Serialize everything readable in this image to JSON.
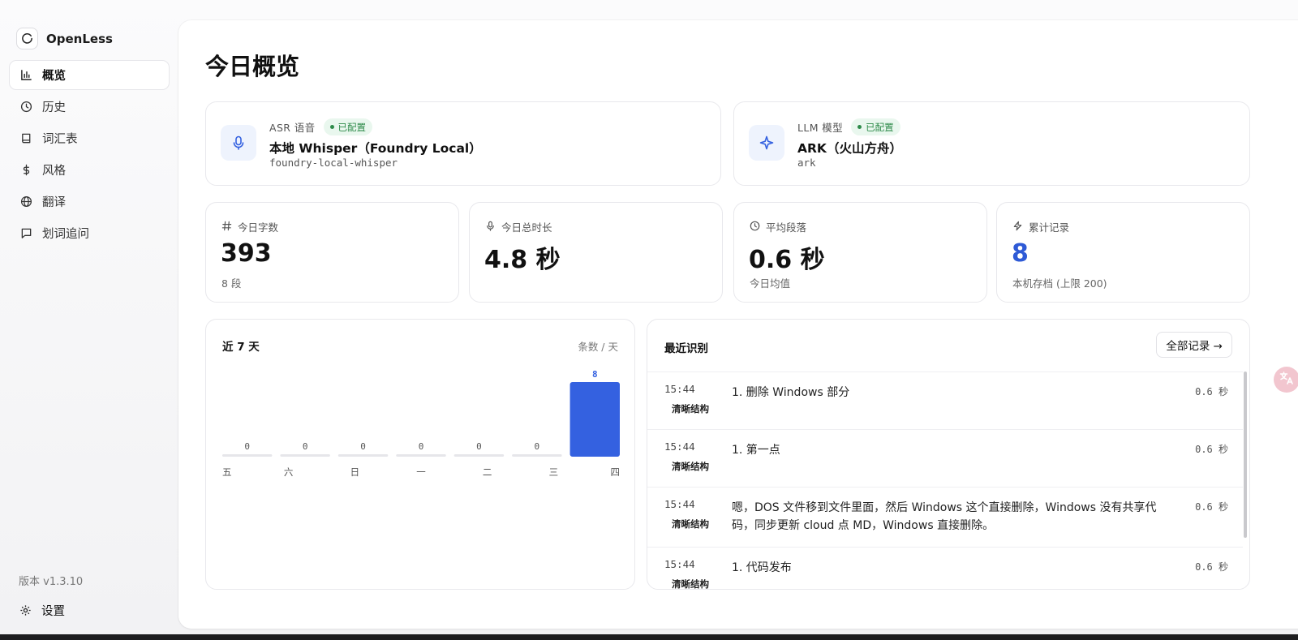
{
  "app": {
    "name": "OpenLess",
    "version": "版本 v1.3.10",
    "settings_label": "设置"
  },
  "sidebar": {
    "items": [
      {
        "label": "概览",
        "icon": "bar-chart-icon",
        "active": true
      },
      {
        "label": "历史",
        "icon": "clock-icon",
        "active": false
      },
      {
        "label": "词汇表",
        "icon": "book-icon",
        "active": false
      },
      {
        "label": "风格",
        "icon": "dollar-icon",
        "active": false
      },
      {
        "label": "翻译",
        "icon": "globe-icon",
        "active": false
      },
      {
        "label": "划词追问",
        "icon": "message-icon",
        "active": false
      }
    ]
  },
  "page": {
    "title": "今日概览"
  },
  "models": {
    "asr": {
      "kind": "ASR 语音",
      "badge": "已配置",
      "name": "本地 Whisper（Foundry Local）",
      "id": "foundry-local-whisper",
      "icon": "microphone-icon"
    },
    "llm": {
      "kind": "LLM 模型",
      "badge": "已配置",
      "name": "ARK（火山方舟）",
      "id": "ark",
      "icon": "sparkle-icon"
    }
  },
  "stats": [
    {
      "label": "今日字数",
      "value": "393",
      "sub": "8 段",
      "icon": "hash-icon"
    },
    {
      "label": "今日总时长",
      "value": "4.8 秒",
      "sub": "",
      "icon": "microphone-icon"
    },
    {
      "label": "平均段落",
      "value": "0.6 秒",
      "sub": "今日均值",
      "icon": "clock-icon"
    },
    {
      "label": "累计记录",
      "value": "8",
      "sub": "本机存档 (上限 200)",
      "icon": "lightning-icon"
    }
  ],
  "chart_data": {
    "type": "bar",
    "title": "近 7 天",
    "unit_label": "条数 / 天",
    "categories": [
      "五",
      "六",
      "日",
      "一",
      "二",
      "三",
      "四"
    ],
    "values": [
      0,
      0,
      0,
      0,
      0,
      0,
      8
    ],
    "ylim": [
      0,
      8
    ],
    "bar_color": "#3461e0",
    "zero_color": "#e6e6ea"
  },
  "recent": {
    "title": "最近识别",
    "all_button": "全部记录 →",
    "rows": [
      {
        "time": "15:44",
        "tag": "清晰结构",
        "text": "1. 删除 Windows 部分",
        "duration": "0.6 秒"
      },
      {
        "time": "15:44",
        "tag": "清晰结构",
        "text": "1. 第一点",
        "duration": "0.6 秒"
      },
      {
        "time": "15:44",
        "tag": "清晰结构",
        "text": "嗯，DOS 文件移到文件里面，然后 Windows 这个直接删除，Windows 没有共享代码，同步更新 cloud 点 MD，Windows 直接删除。",
        "duration": "0.6 秒"
      },
      {
        "time": "15:44",
        "tag": "清晰结构",
        "text": "1. 代码发布",
        "duration": "0.6 秒"
      }
    ]
  },
  "colors": {
    "accent": "#2e5ad6",
    "success": "#2e8b4a",
    "icon_accent": "#3461e0"
  }
}
